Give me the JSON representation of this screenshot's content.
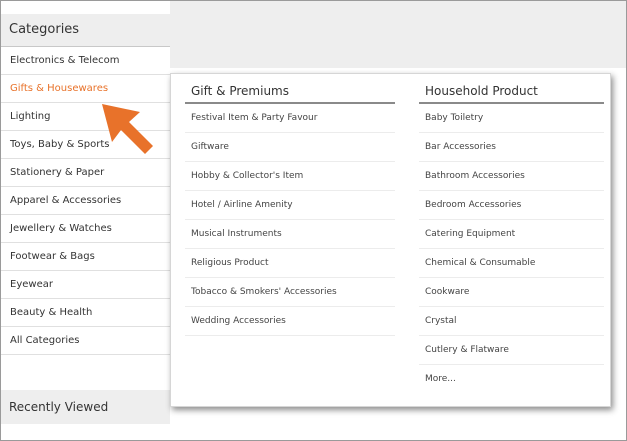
{
  "sidebar": {
    "header": "Categories",
    "items": [
      {
        "label": "Electronics & Telecom",
        "active": false
      },
      {
        "label": "Gifts & Housewares",
        "active": true
      },
      {
        "label": "Lighting",
        "active": false
      },
      {
        "label": "Toys, Baby & Sports",
        "active": false
      },
      {
        "label": "Stationery & Paper",
        "active": false
      },
      {
        "label": "Apparel & Accessories",
        "active": false
      },
      {
        "label": "Jewellery & Watches",
        "active": false
      },
      {
        "label": "Footwear & Bags",
        "active": false
      },
      {
        "label": "Eyewear",
        "active": false
      },
      {
        "label": "Beauty & Health",
        "active": false
      },
      {
        "label": "All Categories",
        "active": false
      }
    ],
    "recently_viewed": "Recently Viewed"
  },
  "submenu": {
    "left": {
      "title": "Gift & Premiums",
      "items": [
        "Festival Item & Party Favour",
        "Giftware",
        "Hobby & Collector's Item",
        "Hotel / Airline Amenity",
        "Musical Instruments",
        "Religious Product",
        "Tobacco & Smokers' Accessories",
        "Wedding Accessories"
      ]
    },
    "right": {
      "title": "Household Product",
      "items": [
        "Baby Toiletry",
        "Bar Accessories",
        "Bathroom Accessories",
        "Bedroom Accessories",
        "Catering Equipment",
        "Chemical & Consumable",
        "Cookware",
        "Crystal",
        "Cutlery & Flatware",
        "More..."
      ]
    }
  },
  "colors": {
    "accent": "#e8722a",
    "band": "#eeeeee"
  },
  "icons": {
    "pointer": "orange-arrow-icon"
  }
}
